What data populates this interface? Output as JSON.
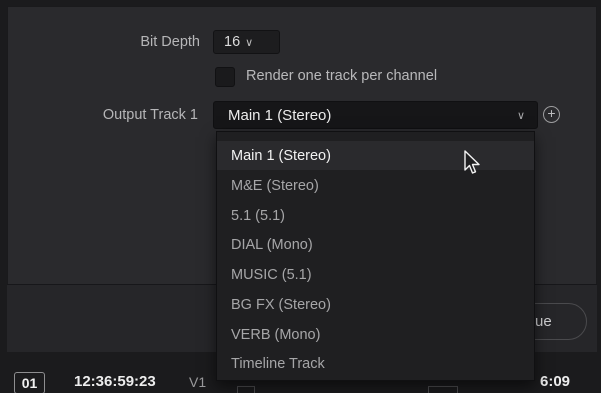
{
  "form": {
    "bit_depth": {
      "label": "Bit Depth",
      "value": "16"
    },
    "render_per_channel": {
      "label": "Render one track per channel",
      "checked": false
    },
    "output_track": {
      "label": "Output Track 1",
      "value": "Main 1 (Stereo)"
    }
  },
  "dropdown": {
    "options": [
      "Main 1 (Stereo)",
      "M&E (Stereo)",
      "5.1 (5.1)",
      "DIAL (Mono)",
      "MUSIC (5.1)",
      "BG FX (Stereo)",
      "VERB (Mono)",
      "Timeline Track"
    ],
    "selected_index": 0
  },
  "queue_button": {
    "label_visible": "ue"
  },
  "timeline": {
    "clip_number": "01",
    "timecode": "12:36:59:23",
    "track": "V1",
    "end_timecode_visible": "6:09"
  },
  "icons": {
    "chevron": "chevron-down-icon",
    "add": "plus-circle-icon",
    "cursor": "mouse-pointer-icon"
  },
  "colors": {
    "panel": "#2a2a2d",
    "dropdown_bg": "#1f1f21",
    "selected_row": "#2a2a2d"
  }
}
